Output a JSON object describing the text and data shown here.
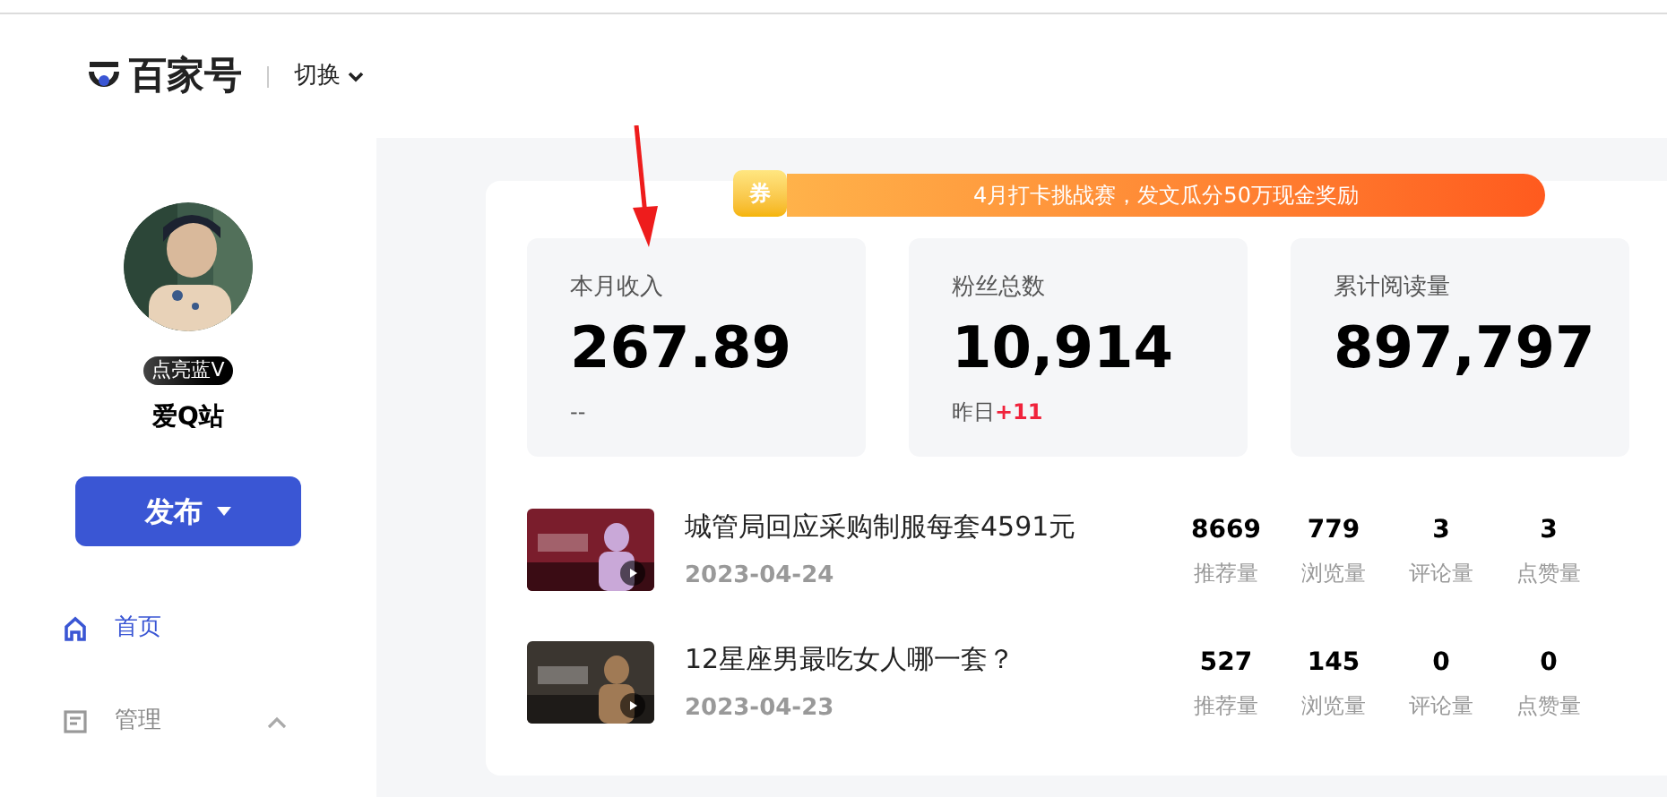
{
  "header": {
    "logo_text": "百家号",
    "switch_label": "切换"
  },
  "sidebar": {
    "badge": "点亮蓝V",
    "username": "爱Q站",
    "publish_button": "发布",
    "nav": [
      {
        "label": "首页",
        "selected": true,
        "kind": "home"
      },
      {
        "label": "管理",
        "selected": false,
        "kind": "manage",
        "expanded": true
      }
    ]
  },
  "banner": {
    "coupon": "券",
    "text": "4月打卡挑战赛，发文瓜分50万现金奖励"
  },
  "stats": [
    {
      "label": "本月收入",
      "value": "267.89",
      "note": "--"
    },
    {
      "label": "粉丝总数",
      "value": "10,914",
      "note": "昨日",
      "delta": "+11"
    },
    {
      "label": "累计阅读量",
      "value": "897,797"
    }
  ],
  "articles": [
    {
      "title": "城管局回应采购制服每套4591元",
      "date": "2023-04-24",
      "metrics": [
        {
          "value": "8669",
          "label": "推荐量"
        },
        {
          "value": "779",
          "label": "浏览量"
        },
        {
          "value": "3",
          "label": "评论量"
        },
        {
          "value": "3",
          "label": "点赞量"
        }
      ]
    },
    {
      "title": "12星座男最吃女人哪一套？",
      "date": "2023-04-23",
      "metrics": [
        {
          "value": "527",
          "label": "推荐量"
        },
        {
          "value": "145",
          "label": "浏览量"
        },
        {
          "value": "0",
          "label": "评论量"
        },
        {
          "value": "0",
          "label": "点赞量"
        }
      ]
    }
  ]
}
